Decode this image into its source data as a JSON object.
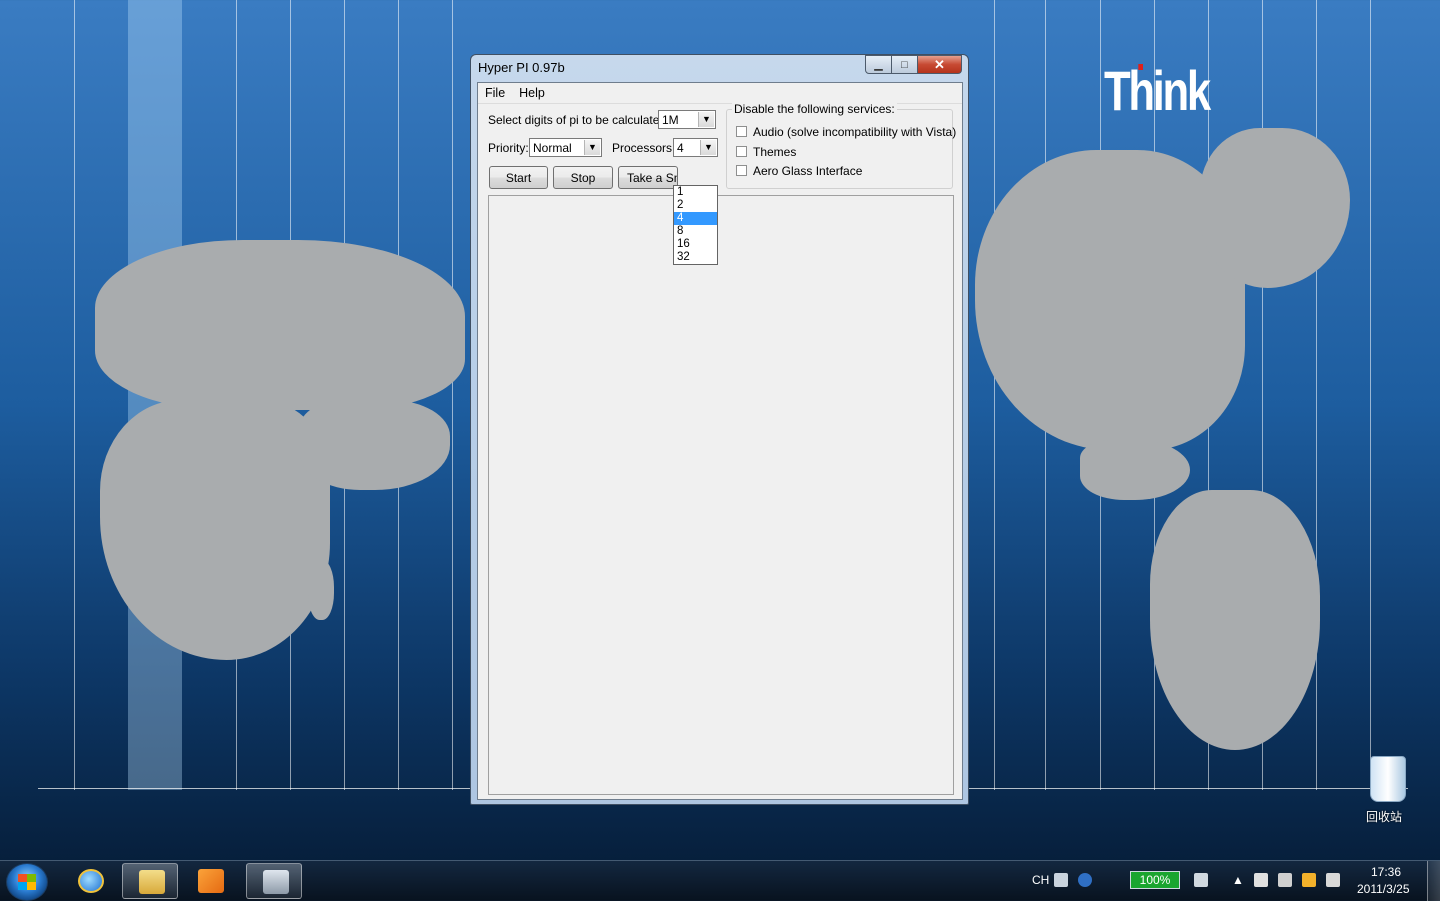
{
  "window": {
    "title": "Hyper PI 0.97b",
    "menu": [
      "File",
      "Help"
    ]
  },
  "controls": {
    "digits_label": "Select digits of pi to be calculated:",
    "digits_value": "1M",
    "priority_label": "Priority:",
    "priority_value": "Normal",
    "processors_label": "Processors:",
    "processors_value": "4",
    "processors_options": [
      "1",
      "2",
      "4",
      "8",
      "16",
      "32"
    ],
    "processors_selected": "4",
    "start_label": "Start",
    "stop_label": "Stop",
    "snapshot_label": "Take a Sn"
  },
  "services": {
    "title": "Disable the following services:",
    "items": [
      {
        "label": "Audio (solve incompatibility with Vista)",
        "checked": false
      },
      {
        "label": "Themes",
        "checked": false
      },
      {
        "label": "Aero Glass Interface",
        "checked": false
      }
    ]
  },
  "desktop": {
    "brand_text": "Think",
    "recycle_bin_label": "回收站",
    "accent_color": "#e0201b"
  },
  "taskbar": {
    "language": "CH",
    "battery": "100%",
    "time": "17:36",
    "date": "2011/3/25",
    "apps": [
      "internet-explorer",
      "file-explorer",
      "media-player",
      "hyper-pi"
    ]
  }
}
